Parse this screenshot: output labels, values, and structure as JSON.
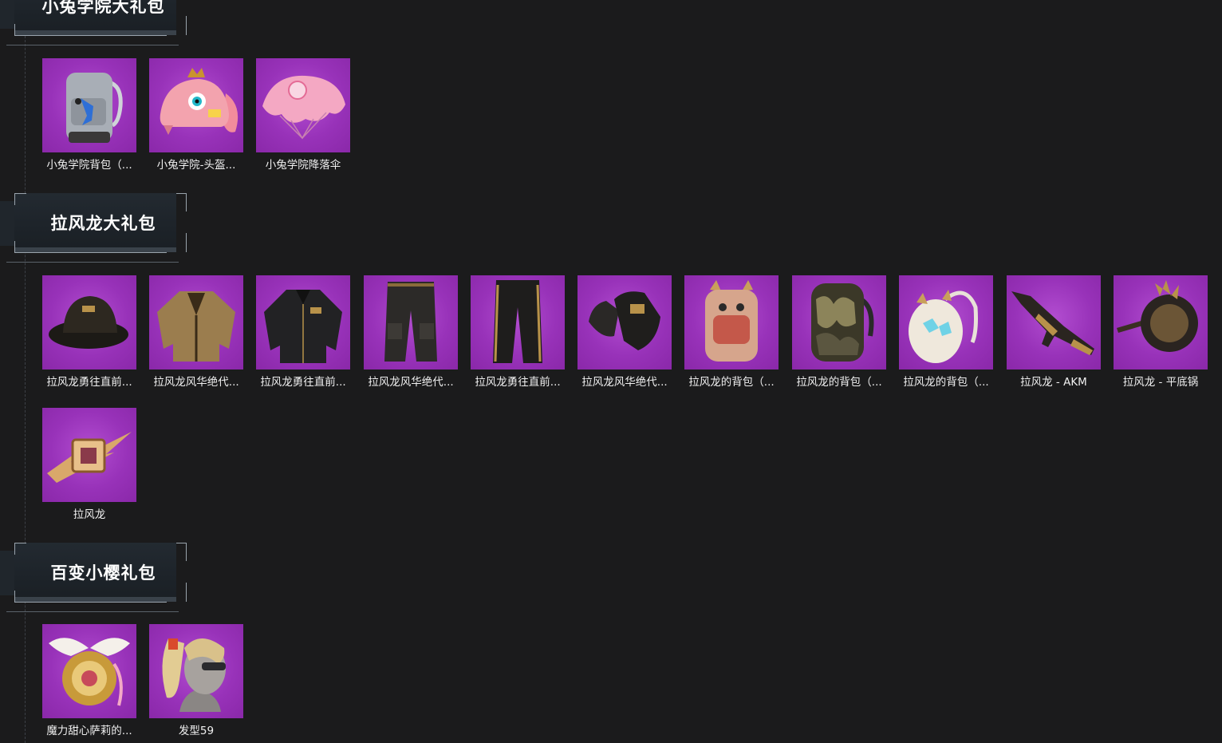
{
  "sections": [
    {
      "title": "小兔学院大礼包",
      "items": [
        {
          "label": "小兔学院背包（...",
          "icon": "bunny-backpack-icon"
        },
        {
          "label": "小兔学院-头盔...",
          "icon": "bunny-helmet-icon"
        },
        {
          "label": "小兔学院降落伞",
          "icon": "parachute-icon"
        }
      ]
    },
    {
      "title": "拉风龙大礼包",
      "items": [
        {
          "label": "拉风龙勇往直前...",
          "icon": "bucket-hat-icon"
        },
        {
          "label": "拉风龙风华绝代...",
          "icon": "gold-jacket-icon"
        },
        {
          "label": "拉风龙勇往直前...",
          "icon": "black-jacket-icon"
        },
        {
          "label": "拉风龙风华绝代...",
          "icon": "cargo-pants-icon"
        },
        {
          "label": "拉风龙勇往直前...",
          "icon": "track-pants-icon"
        },
        {
          "label": "拉风龙风华绝代...",
          "icon": "gloves-icon"
        },
        {
          "label": "拉风龙的背包（...",
          "icon": "dragon-backpack-icon"
        },
        {
          "label": "拉风龙的背包（...",
          "icon": "camo-backpack-icon"
        },
        {
          "label": "拉风龙的背包（...",
          "icon": "egg-backpack-icon"
        },
        {
          "label": "拉风龙 - AKM",
          "icon": "rifle-icon"
        },
        {
          "label": "拉风龙 - 平底锅",
          "icon": "pan-icon"
        },
        {
          "label": "拉风龙",
          "icon": "dragon-emblem-icon"
        }
      ]
    },
    {
      "title": "百变小樱礼包",
      "items": [
        {
          "label": "魔力甜心萨莉的...",
          "icon": "winged-backpack-icon"
        },
        {
          "label": "发型59",
          "icon": "hairstyle-icon"
        }
      ]
    }
  ],
  "colors": {
    "background": "#1b1b1c",
    "card": "#9832b9",
    "accent_gold": "#b8924a"
  }
}
